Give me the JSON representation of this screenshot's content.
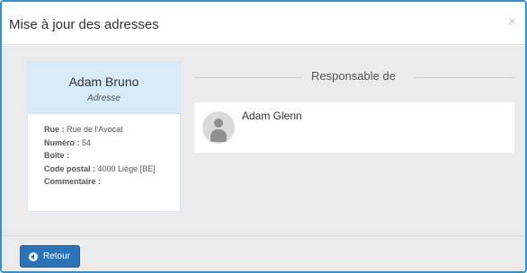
{
  "modal": {
    "title": "Mise à jour des adresses",
    "close_symbol": "×"
  },
  "person": {
    "name": "Adam Bruno",
    "subtitle": "Adresse",
    "fields": {
      "street_label": "Rue :",
      "street_value": "Rue de l'Avocat",
      "number_label": "Numéro :",
      "number_value": "54",
      "box_label": "Boîte :",
      "box_value": "",
      "postal_label": "Code postal :",
      "postal_value": "4000 Liège [BE]",
      "comment_label": "Commentaire :",
      "comment_value": ""
    }
  },
  "responsible": {
    "heading": "Responsable de",
    "items": [
      {
        "name": "Adam Glenn",
        "icon": "user-avatar-icon"
      }
    ]
  },
  "footer": {
    "back_label": "Retour",
    "back_icon": "arrow-circle-left-icon"
  },
  "colors": {
    "accent": "#2b73b6",
    "card_header": "#d6eaf8",
    "body_background": "#ebebeb"
  }
}
